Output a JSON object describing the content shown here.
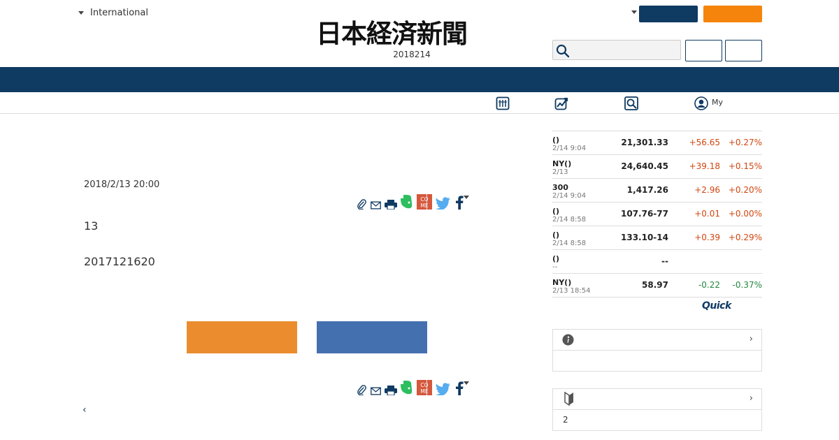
{
  "header": {
    "edition_label": "International",
    "logo_text": "日本経済新聞",
    "date": "2018214",
    "my_label": "My"
  },
  "article": {
    "date": "2018/2/13 20:00",
    "paragraph1": "13",
    "paragraph2": "2017121620"
  },
  "icons": {
    "share": [
      "clip-icon",
      "mail-icon",
      "print-icon",
      "evernote-icon",
      "come-icon",
      "twitter-icon",
      "facebook-icon",
      "more-caret-icon"
    ],
    "subnav": [
      "markets-board-icon",
      "chart-icon",
      "search-stock-icon",
      "user-icon"
    ]
  },
  "colors": {
    "navy": "#0f3a62",
    "orange": "#f5840c",
    "cta_orange": "#eb8d2f",
    "cta_blue": "#4470b0",
    "up": "#d2460f",
    "down": "#23873d"
  },
  "markets": {
    "rows": [
      {
        "name": "()",
        "time": "2/14 9:04",
        "value": "21,301.33",
        "change": "+56.65",
        "pct": "+0.27%",
        "dir": "up"
      },
      {
        "name": "NY()",
        "time": "2/13",
        "value": "24,640.45",
        "change": "+39.18",
        "pct": "+0.15%",
        "dir": "up"
      },
      {
        "name": "300",
        "time": "2/14 9:04",
        "value": "1,417.26",
        "change": "+2.96",
        "pct": "+0.20%",
        "dir": "up"
      },
      {
        "name": "()",
        "time": "2/14 8:58",
        "value": "107.76-77",
        "change": "+0.01",
        "pct": "+0.00%",
        "dir": "up"
      },
      {
        "name": "()",
        "time": "2/14 8:58",
        "value": "133.10-14",
        "change": "+0.39",
        "pct": "+0.29%",
        "dir": "up"
      },
      {
        "name": "()",
        "time": "--",
        "value": "--",
        "change": "",
        "pct": "",
        "dir": "up"
      },
      {
        "name": "NY()",
        "time": "2/13 18:54",
        "value": "58.97",
        "change": "-0.22",
        "pct": "-0.37%",
        "dir": "down"
      }
    ],
    "provider": "Quick"
  },
  "sidebar_box2": {
    "body": "2"
  }
}
